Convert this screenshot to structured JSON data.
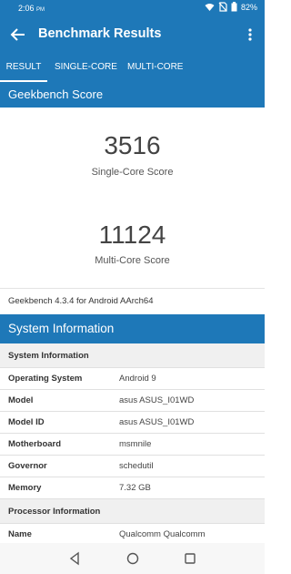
{
  "status_bar": {
    "time": "2:06",
    "ampm": "PM",
    "battery": "82%"
  },
  "app_bar": {
    "title": "Benchmark Results"
  },
  "tabs": [
    {
      "label": "RESULT",
      "active": true
    },
    {
      "label": "SINGLE-CORE",
      "active": false
    },
    {
      "label": "MULTI-CORE",
      "active": false
    }
  ],
  "geekbench": {
    "header": "Geekbench Score",
    "single_value": "3516",
    "single_label": "Single-Core Score",
    "multi_value": "11124",
    "multi_label": "Multi-Core Score",
    "version": "Geekbench 4.3.4 for Android AArch64"
  },
  "system": {
    "header": "System Information",
    "rows": [
      {
        "key": "System Information",
        "value": "",
        "group": true
      },
      {
        "key": "Operating System",
        "value": "Android 9"
      },
      {
        "key": "Model",
        "value": "asus ASUS_I01WD"
      },
      {
        "key": "Model ID",
        "value": "asus ASUS_I01WD"
      },
      {
        "key": "Motherboard",
        "value": "msmnile"
      },
      {
        "key": "Governor",
        "value": "schedutil"
      },
      {
        "key": "Memory",
        "value": "7.32 GB"
      },
      {
        "key": "Processor Information",
        "value": "",
        "group": true
      },
      {
        "key": "Name",
        "value": "Qualcomm Qualcomm"
      }
    ]
  },
  "colors": {
    "primary": "#1e78b8"
  }
}
